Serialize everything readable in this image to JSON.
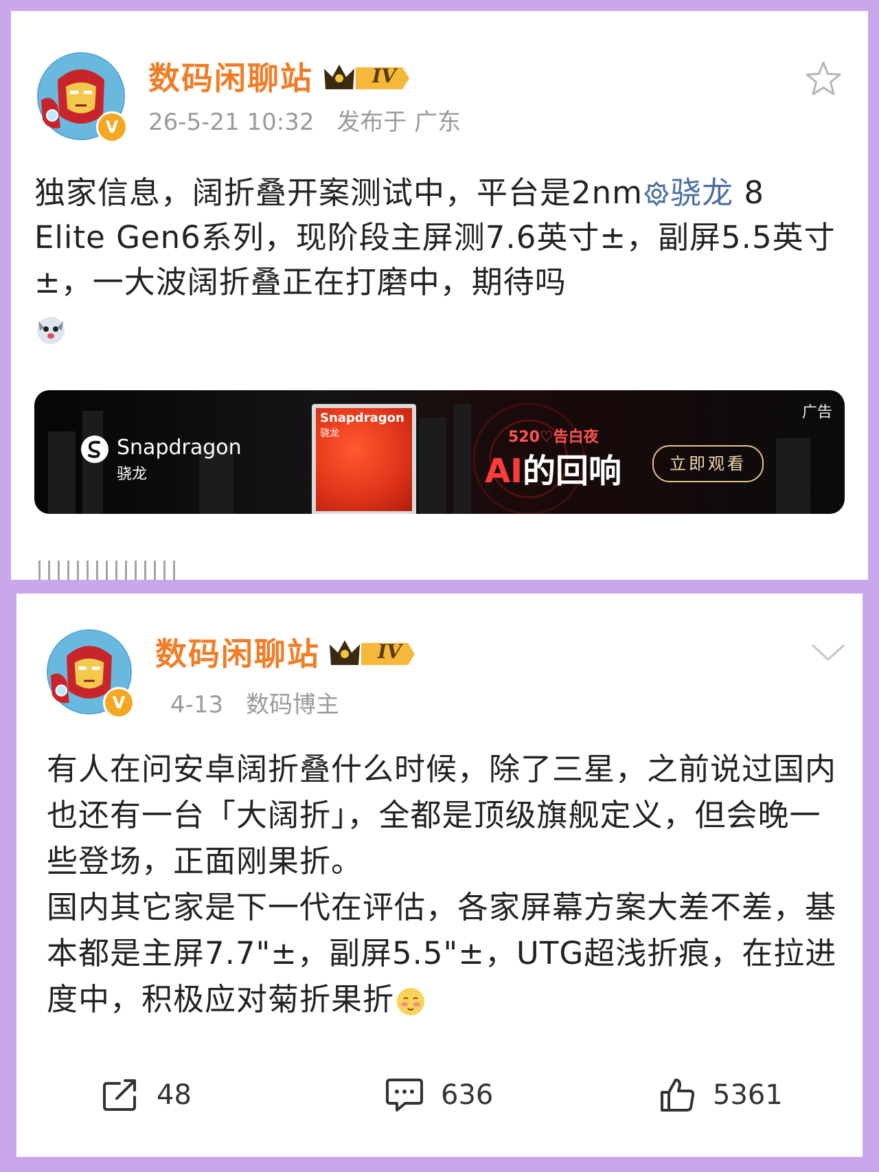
{
  "post_1": {
    "username": "数码闲聊站",
    "level_badge": "IV",
    "timestamp": "26-5-21 10:32",
    "location": "发布于 广东",
    "text_before_topic": "独家信息，阔折叠开案测试中，平台是2nm",
    "topic": "骁龙",
    "text_after_topic": " 8 Elite Gen6系列，现阶段主屏测7.6英寸±，副屏5.5英寸±，一大波阔折叠正在打磨中，期待吗",
    "ad": {
      "label": "广告",
      "brand": "Snapdragon",
      "brand_sub": "骁龙",
      "chip_text": "Snapdragon",
      "chip_text_sub": "骁龙",
      "event": "520♡告白夜",
      "headline_ai": "AI",
      "headline_rest": "的回响",
      "cta": "立即观看"
    }
  },
  "post_2": {
    "username": "数码闲聊站",
    "level_badge": "IV",
    "timestamp": "4-13",
    "source": "数码博主",
    "paragraph_1": "有人在问安卓阔折叠什么时候，除了三星，之前说过国内也还有一台「大阔折」，全都是顶级旗舰定义，但会晚一些登场，正面刚果折。",
    "paragraph_2": "国内其它家是下一代在评估，各家屏幕方案大差不差，基本都是主屏7.7\"±，副屏5.5\"±，UTG超浅折痕，在拉进度中，积极应对菊折果折",
    "actions": {
      "share_count": "48",
      "comment_count": "636",
      "like_count": "5361"
    }
  },
  "colors": {
    "background": "#c8a8ea",
    "username": "#f07e28",
    "topic": "#4b6ea6",
    "meta": "#9a9a9a"
  },
  "icons": [
    "star-icon",
    "chevron-down-icon",
    "share-icon",
    "comment-icon",
    "like-icon",
    "verified-v-icon",
    "crown-icon"
  ]
}
